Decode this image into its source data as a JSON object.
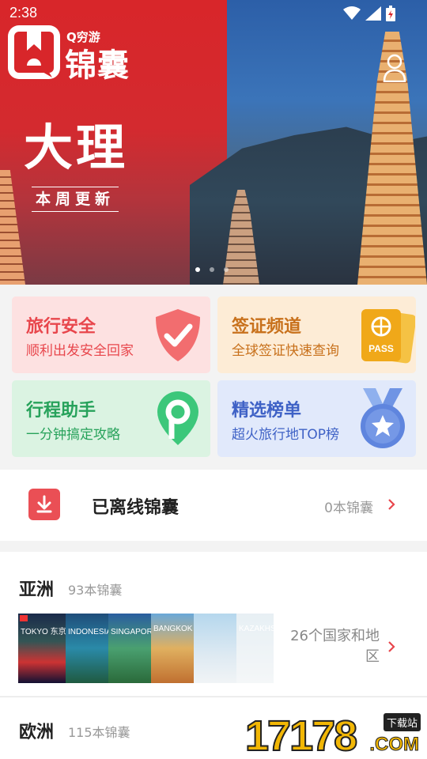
{
  "status_bar": {
    "time": "2:38"
  },
  "header": {
    "brand_small": "Q穷游",
    "brand_big": "锦囊",
    "brand_mark": "TM"
  },
  "hero": {
    "city": "大理",
    "tag": "本周更新",
    "slides": 3,
    "active_slide": 1
  },
  "features": [
    {
      "title": "旅行安全",
      "subtitle": "顺利出发安全回家",
      "icon": "shield-check-icon",
      "color": "#e8464c"
    },
    {
      "title": "签证频道",
      "subtitle": "全球签证快速查询",
      "icon": "passport-icon",
      "icon_text": "PASS",
      "color": "#c8711c"
    },
    {
      "title": "行程助手",
      "subtitle": "一分钟搞定攻略",
      "icon": "map-pin-icon",
      "color": "#27a25b"
    },
    {
      "title": "精选榜单",
      "subtitle": "超火旅行地TOP榜",
      "icon": "medal-star-icon",
      "color": "#3f62c6"
    }
  ],
  "offline": {
    "label": "已离线锦囊",
    "count": "0本锦囊"
  },
  "continents": [
    {
      "name": "亚洲",
      "count": "93本锦囊",
      "desc": "26个国家和地区",
      "covers": [
        "TOKYO 东京",
        "INDONESIA 印度尼西亚",
        "SINGAPORE 新加坡",
        "BANGKOK",
        "",
        "KAZAKHSTAN"
      ]
    },
    {
      "name": "欧洲",
      "count": "115本锦囊"
    }
  ],
  "watermark": {
    "digits": "17178",
    "tag": "下载站",
    "suffix": ".COM"
  }
}
